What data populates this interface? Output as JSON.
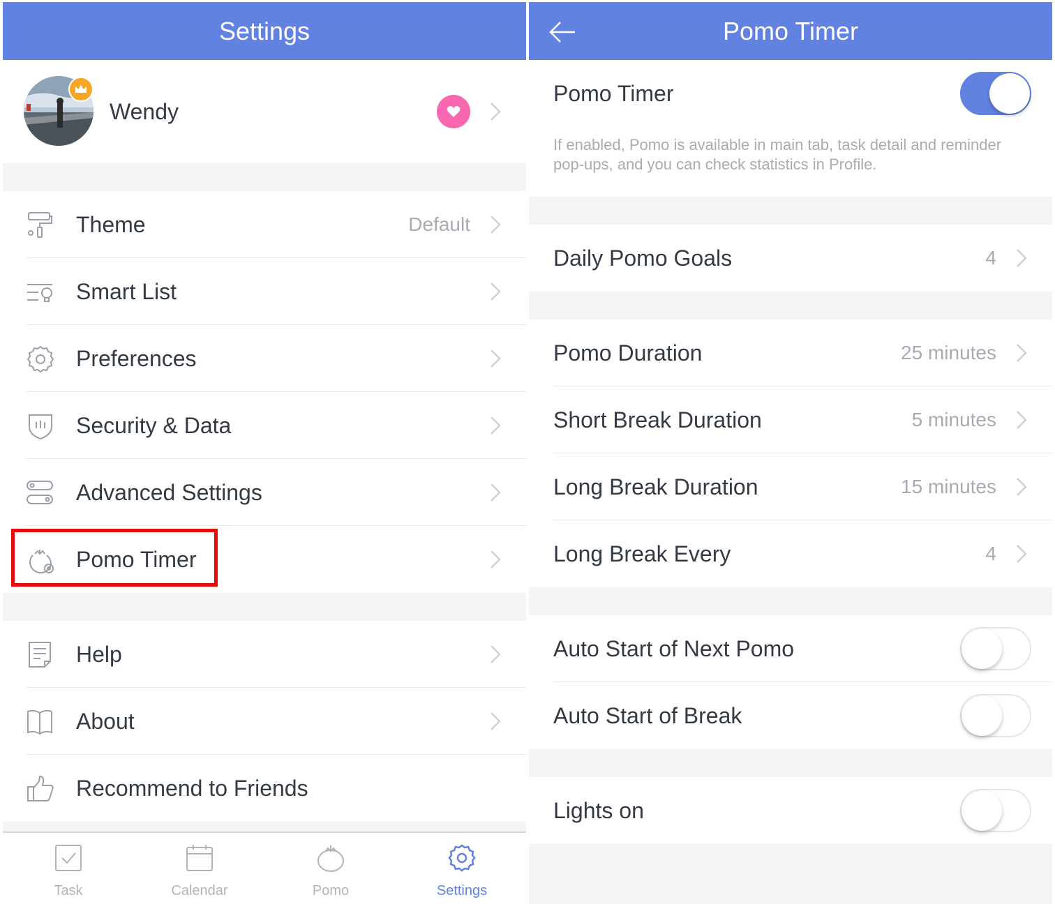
{
  "left": {
    "header": {
      "title": "Settings"
    },
    "profile": {
      "name": "Wendy"
    },
    "menu": [
      {
        "label": "Theme",
        "value": "Default",
        "icon": "paint-roller-icon"
      },
      {
        "label": "Smart List",
        "icon": "smart-list-icon"
      },
      {
        "label": "Preferences",
        "icon": "gear-icon"
      },
      {
        "label": "Security & Data",
        "icon": "shield-icon"
      },
      {
        "label": "Advanced Settings",
        "icon": "toggles-icon"
      },
      {
        "label": "Pomo Timer",
        "icon": "tomato-gear-icon"
      },
      {
        "label": "Help",
        "icon": "document-icon"
      },
      {
        "label": "About",
        "icon": "book-icon"
      },
      {
        "label": "Recommend to Friends",
        "icon": "thumbs-up-icon"
      }
    ],
    "tabbar": [
      {
        "label": "Task",
        "icon": "checkbox-icon",
        "active": false
      },
      {
        "label": "Calendar",
        "icon": "calendar-icon",
        "active": false
      },
      {
        "label": "Pomo",
        "icon": "tomato-icon",
        "active": false
      },
      {
        "label": "Settings",
        "icon": "gear-icon",
        "active": true
      }
    ]
  },
  "right": {
    "header": {
      "title": "Pomo Timer"
    },
    "pomo_toggle": {
      "label": "Pomo Timer",
      "on": true
    },
    "description": "If enabled, Pomo is available in main tab, task detail and reminder pop-ups, and you can check statistics in Profile.",
    "daily_goals": {
      "label": "Daily Pomo Goals",
      "value": "4"
    },
    "durations": [
      {
        "label": "Pomo Duration",
        "value": "25 minutes"
      },
      {
        "label": "Short Break Duration",
        "value": "5 minutes"
      },
      {
        "label": "Long Break Duration",
        "value": "15 minutes"
      },
      {
        "label": "Long Break Every",
        "value": "4"
      }
    ],
    "auto": [
      {
        "label": "Auto Start of Next Pomo",
        "on": false
      },
      {
        "label": "Auto Start of Break",
        "on": false
      }
    ],
    "lights": {
      "label": "Lights on",
      "on": false
    }
  },
  "colors": {
    "accent": "#6182e0",
    "highlight": "#e80b0b",
    "badge": "#f867b0",
    "crown": "#f5a623"
  }
}
